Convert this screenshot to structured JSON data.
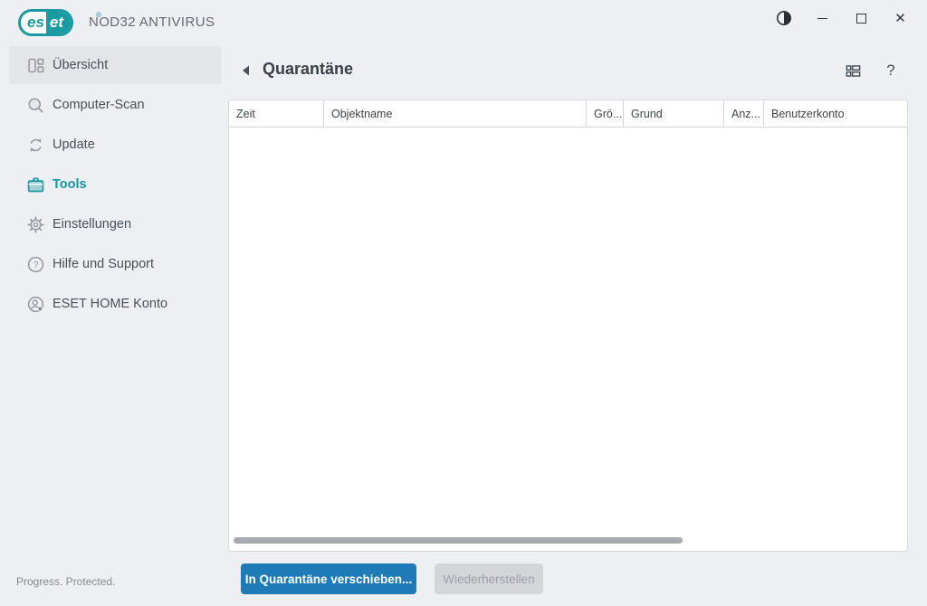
{
  "titlebar": {
    "logo": {
      "part_outline": "es",
      "part_filled": "et",
      "registered_mark": "®"
    },
    "product_name": "NOD32 ANTIVIRUS"
  },
  "sidebar": {
    "items": [
      {
        "label": "Übersicht"
      },
      {
        "label": "Computer-Scan"
      },
      {
        "label": "Update"
      },
      {
        "label": "Tools"
      },
      {
        "label": "Einstellungen"
      },
      {
        "label": "Hilfe und Support"
      },
      {
        "label": "ESET HOME Konto"
      }
    ],
    "highlighted_item": "Übersicht",
    "active_section": "Tools"
  },
  "main": {
    "title": "Quarantäne",
    "help_glyph": "?",
    "table": {
      "columns": [
        {
          "label": "Zeit"
        },
        {
          "label": "Objektname"
        },
        {
          "label": "Grö..."
        },
        {
          "label": "Grund"
        },
        {
          "label": "Anz..."
        },
        {
          "label": "Benutzerkonto"
        }
      ],
      "rows": []
    },
    "buttons": {
      "move_to_quarantine": {
        "label": "In Quarantäne verschieben...",
        "enabled": true
      },
      "restore": {
        "label": "Wiederherstellen",
        "enabled": false
      }
    }
  },
  "statusbar": {
    "text": "Progress. Protected."
  },
  "colors": {
    "accent_teal": "#1a9aa1",
    "primary_button_blue": "#1e7bb8",
    "background": "#edeff3",
    "panel": "#ffffff",
    "selected_item_bg": "#e3e5e9",
    "icon_gray": "#96999e",
    "scrollbar_gray": "#a7aaae"
  }
}
